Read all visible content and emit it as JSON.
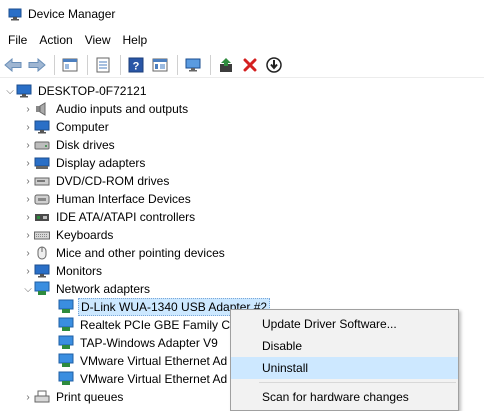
{
  "window": {
    "title": "Device Manager"
  },
  "menu": [
    "File",
    "Action",
    "View",
    "Help"
  ],
  "toolbar": {
    "buttons": [
      {
        "name": "back-icon",
        "color": "#6a8fb8"
      },
      {
        "name": "forward-icon",
        "color": "#6a8fb8"
      },
      {
        "name": "show-hide-console-tree-icon",
        "color": "#4c7fbf"
      },
      {
        "name": "properties-icon",
        "color": "#4c7fbf"
      },
      {
        "name": "help-icon",
        "color": "#2a56a6"
      },
      {
        "name": "view-icon",
        "color": "#4c7fbf"
      },
      {
        "name": "scan-hardware-icon",
        "color": "#2a6fc7"
      },
      {
        "name": "update-driver-icon",
        "color": "#2e8b3e"
      },
      {
        "name": "uninstall-icon",
        "color": "#d42020"
      },
      {
        "name": "disable-device-icon",
        "color": "#222222"
      }
    ]
  },
  "tree": {
    "root": "DESKTOP-0F72121",
    "categories": [
      {
        "label": "Audio inputs and outputs",
        "icon": "speaker-icon"
      },
      {
        "label": "Computer",
        "icon": "computer-icon"
      },
      {
        "label": "Disk drives",
        "icon": "disk-drive-icon"
      },
      {
        "label": "Display adapters",
        "icon": "display-adapter-icon"
      },
      {
        "label": "DVD/CD-ROM drives",
        "icon": "dvd-drive-icon"
      },
      {
        "label": "Human Interface Devices",
        "icon": "hid-icon"
      },
      {
        "label": "IDE ATA/ATAPI controllers",
        "icon": "ide-controller-icon"
      },
      {
        "label": "Keyboards",
        "icon": "keyboard-icon"
      },
      {
        "label": "Mice and other pointing devices",
        "icon": "mouse-icon"
      },
      {
        "label": "Monitors",
        "icon": "monitor-icon"
      },
      {
        "label": "Network adapters",
        "icon": "network-adapter-icon",
        "expanded": true
      }
    ],
    "network_adapters": [
      "D-Link WUA-1340 USB Adapter #2",
      "Realtek PCIe GBE Family Co",
      "TAP-Windows Adapter V9",
      "VMware Virtual Ethernet Ad",
      "VMware Virtual Ethernet Ad"
    ],
    "after": {
      "label": "Print queues",
      "icon": "printer-icon"
    }
  },
  "context_menu": {
    "items": [
      "Update Driver Software...",
      "Disable",
      "Uninstall",
      "Scan for hardware changes"
    ],
    "highlighted": "Uninstall"
  }
}
